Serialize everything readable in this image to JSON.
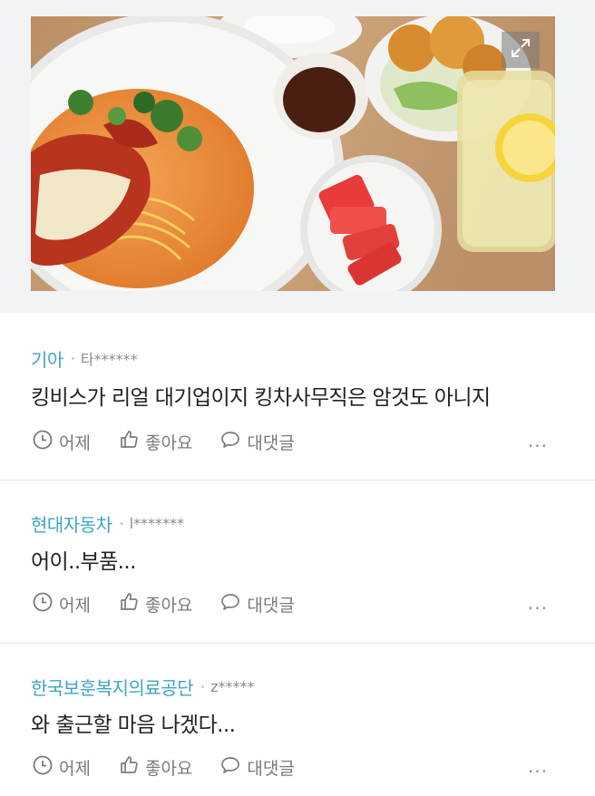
{
  "post_image": {
    "description_icon": "food-photo",
    "expand_icon": "expand-icon"
  },
  "comments": [
    {
      "company": "기아",
      "separator": "·",
      "author": "타******",
      "text": "킹비스가 리얼 대기업이지 킹차사무직은 암것도 아니지",
      "time_label": "어제",
      "like_label": "좋아요",
      "reply_label": "대댓글",
      "more_label": "···"
    },
    {
      "company": "현대자동차",
      "separator": "·",
      "author": "l*******",
      "text": "어이..부품...",
      "time_label": "어제",
      "like_label": "좋아요",
      "reply_label": "대댓글",
      "more_label": "···"
    },
    {
      "company": "한국보훈복지의료공단",
      "separator": "·",
      "author": "z*****",
      "text": "와 출근할 마음 나겠다...",
      "time_label": "어제",
      "like_label": "좋아요",
      "reply_label": "대댓글",
      "more_label": "···"
    }
  ],
  "colors": {
    "company": "#3ea6c2",
    "text": "#222222",
    "muted": "#7a7a7a",
    "divider": "#e7e8ea"
  }
}
